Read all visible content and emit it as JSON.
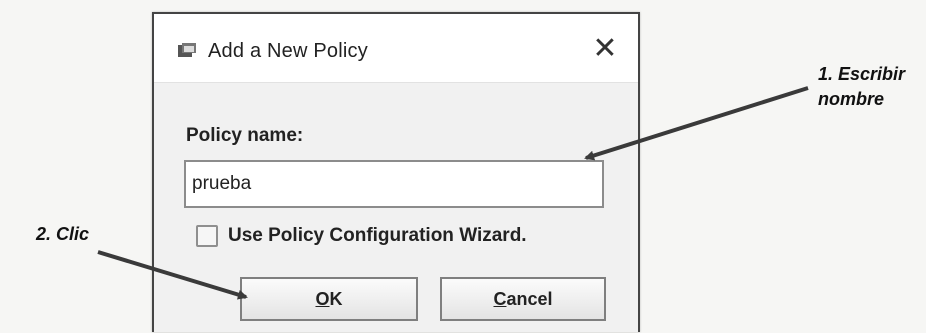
{
  "dialog": {
    "title": "Add a New Policy",
    "close_label": "✕",
    "policy_name_label": "Policy name:",
    "policy_name_value": "prueba",
    "wizard_checkbox_label": "Use Policy Configuration Wizard.",
    "wizard_checkbox_checked": false,
    "ok_button": {
      "mnemonic": "O",
      "rest": "K"
    },
    "cancel_button": {
      "mnemonic": "C",
      "rest": "ancel"
    }
  },
  "annotations": {
    "step1_line1": "1. Escribir",
    "step1_line2": "nombre",
    "step2": "2. Clic"
  },
  "colors": {
    "arrow": "#3a3a3a",
    "dialog_border": "#444444"
  },
  "icons": {
    "app": "java-window-icon",
    "close": "close-icon"
  }
}
